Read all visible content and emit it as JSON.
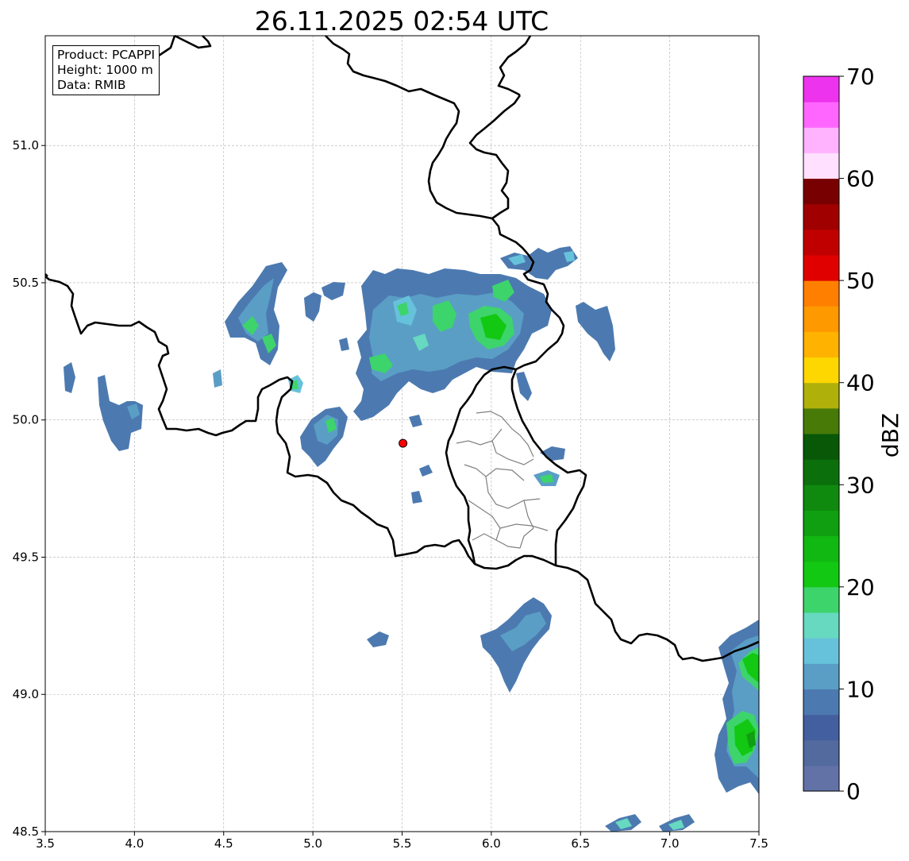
{
  "title": "26.11.2025 02:54 UTC",
  "info": {
    "product": "Product: PCAPPI",
    "height": "Height: 1000 m",
    "data": "Data: RMIB"
  },
  "map": {
    "lon_range": [
      3.5,
      7.5
    ],
    "lat_range": [
      48.5,
      51.4
    ],
    "x_ticks": [
      "3.5",
      "4.0",
      "4.5",
      "5.0",
      "5.5",
      "6.0",
      "6.5",
      "7.0",
      "7.5"
    ],
    "y_ticks": [
      "48.5",
      "49.0",
      "49.5",
      "50.0",
      "50.5",
      "51.0"
    ],
    "grid": true,
    "radar_site": {
      "lon": 5.505,
      "lat": 49.915,
      "color": "#ff0000"
    }
  },
  "colorbar": {
    "label": "dBZ",
    "ticks": [
      "0",
      "10",
      "20",
      "30",
      "40",
      "50",
      "60",
      "70"
    ],
    "range": [
      0,
      70
    ],
    "step": 2.5,
    "colors": [
      "#6272a6",
      "#536a9e",
      "#445fa0",
      "#4c7ab0",
      "#5a9ec6",
      "#66c2da",
      "#66d9c0",
      "#3dd46c",
      "#12c812",
      "#12b812",
      "#109f10",
      "#0f8a0f",
      "#0b700b",
      "#085808",
      "#487a08",
      "#afb00a",
      "#ffd700",
      "#ffb300",
      "#ff9900",
      "#ff7f00",
      "#e00000",
      "#c00000",
      "#a00000",
      "#780000",
      "#ffe0ff",
      "#ffb3ff",
      "#ff66ff",
      "#ee33ee"
    ]
  }
}
